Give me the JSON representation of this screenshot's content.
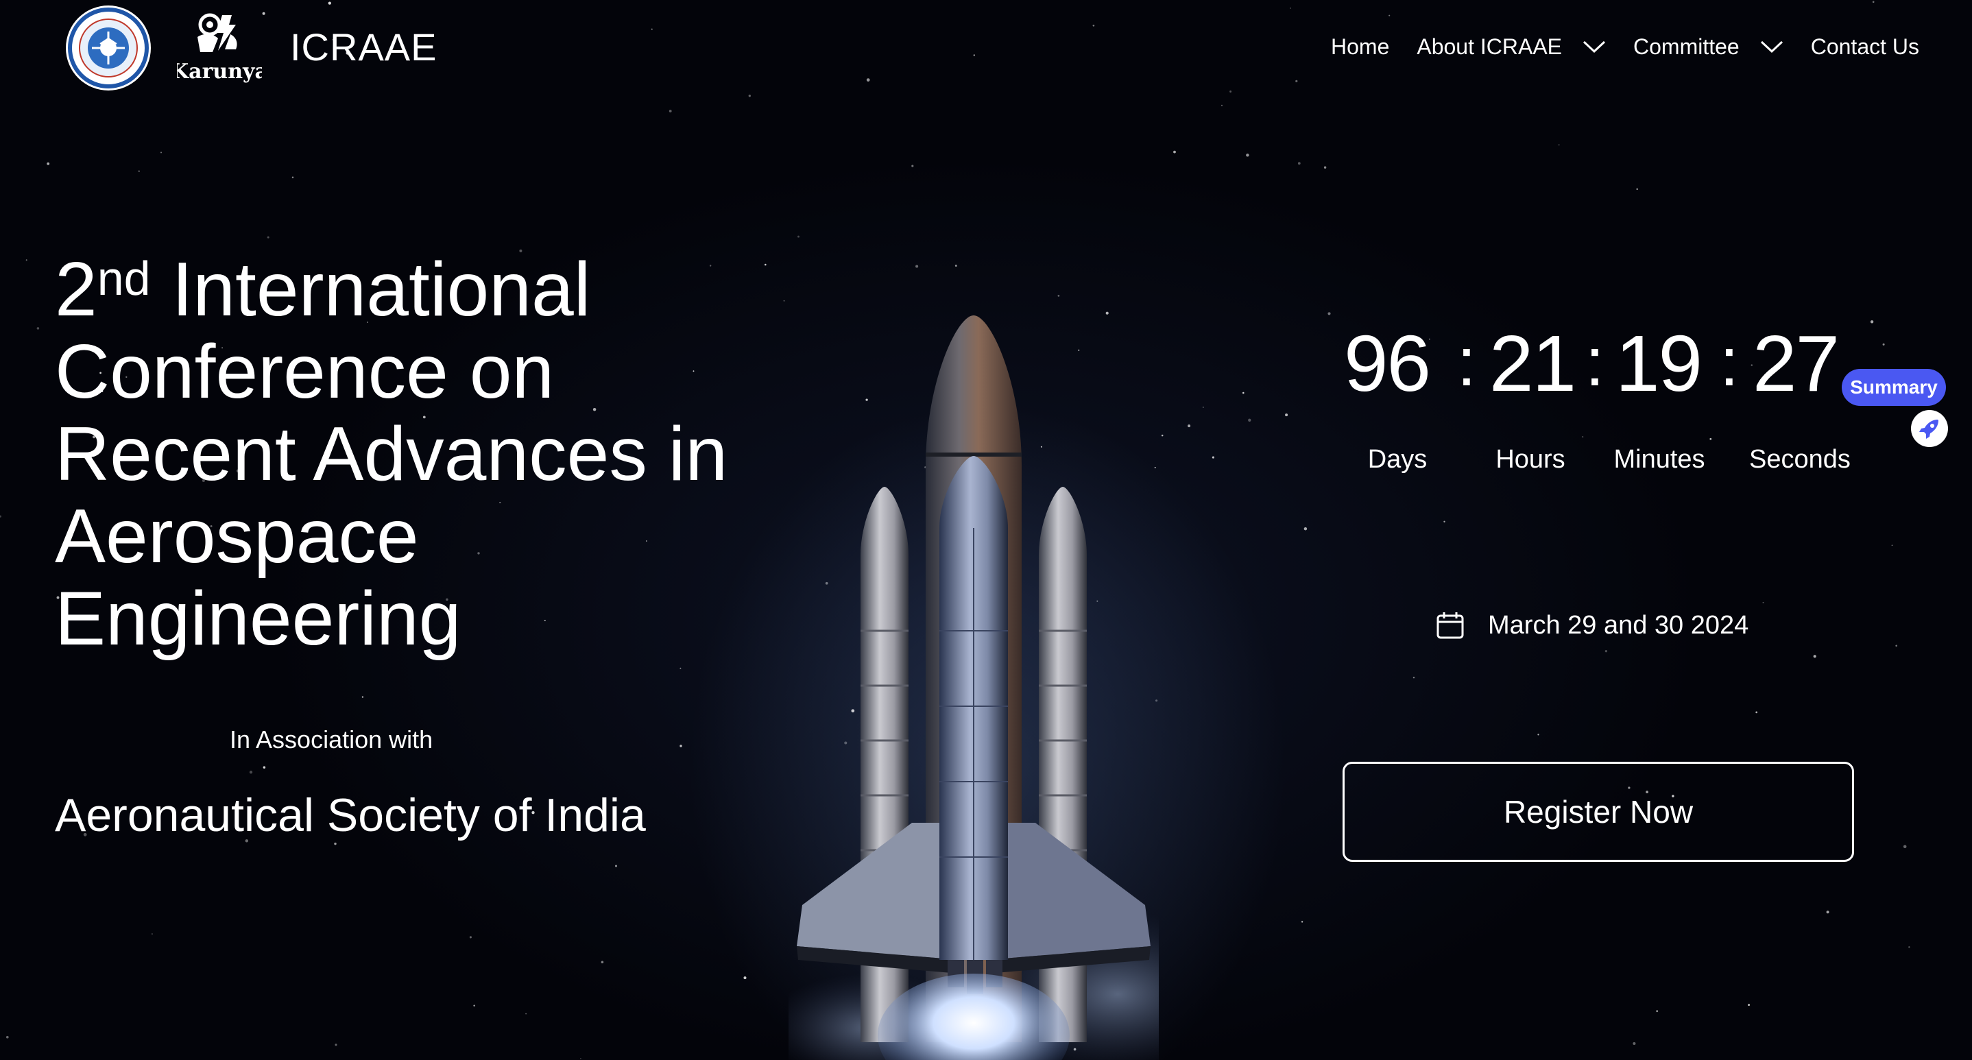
{
  "header": {
    "brand": "ICRAAE",
    "logo1_text": "THE AERONAUTICAL SOCIETY OF INDIA",
    "logo2_text": "Karunya",
    "nav": [
      {
        "label": "Home",
        "has_dropdown": false
      },
      {
        "label": "About ICRAAE",
        "has_dropdown": true
      },
      {
        "label": "Committee",
        "has_dropdown": true
      },
      {
        "label": "Contact Us",
        "has_dropdown": false
      }
    ]
  },
  "hero": {
    "title_ordinal": "2",
    "title_sup": "nd",
    "title_line1_rest": " International",
    "title_line2": "Conference on",
    "title_line3": "Recent Advances in",
    "title_line4": "Aerospace",
    "title_line5": "Engineering",
    "association_label": "In Association with",
    "society": "Aeronautical Society of India"
  },
  "countdown": {
    "days": "96",
    "hours": "21",
    "minutes": "19",
    "seconds": "27",
    "separator": ":",
    "labels": {
      "days": "Days",
      "hours": "Hours",
      "minutes": "Minutes",
      "seconds": "Seconds"
    }
  },
  "event": {
    "date": "March 29 and 30 2024",
    "register_label": "Register Now"
  },
  "widget": {
    "summary_label": "Summary"
  },
  "colors": {
    "background": "#03040a",
    "text": "#ffffff",
    "summary_badge": "#4a58f2"
  },
  "icons": {
    "calendar": "calendar-icon",
    "chevron": "chevron-down-icon",
    "summary": "rocket-icon"
  }
}
